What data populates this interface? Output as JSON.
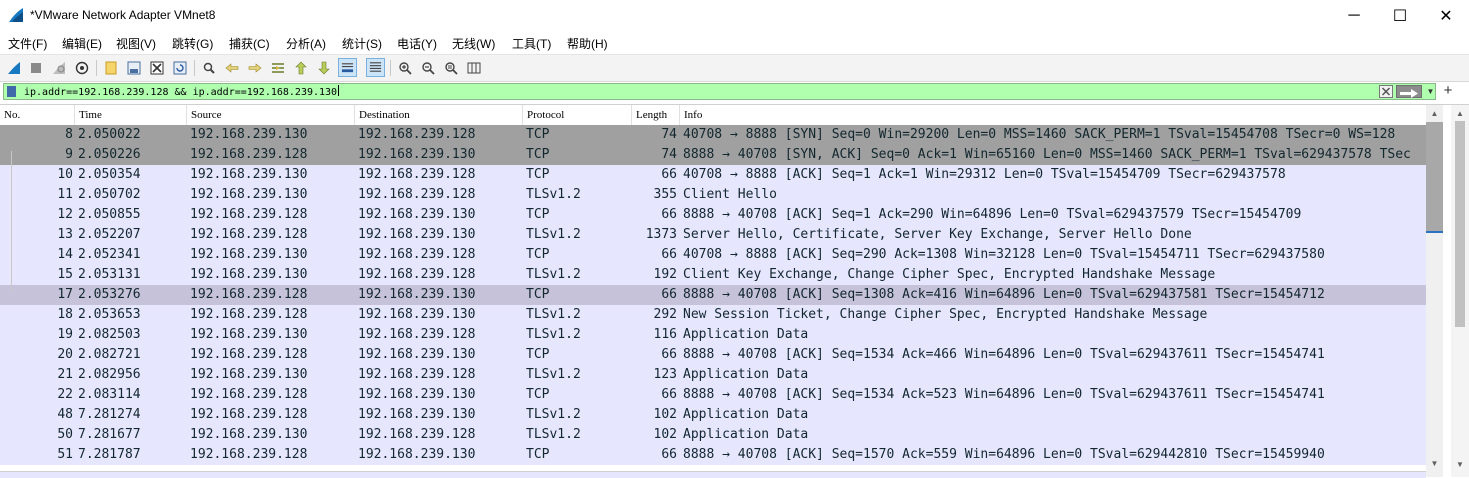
{
  "window": {
    "title": "*VMware Network Adapter VMnet8",
    "minimize_glyph": "─",
    "maximize_glyph": "☐",
    "close_glyph": "✕",
    "app_icon": "wireshark-fin-icon"
  },
  "menu": [
    "文件(F)",
    "编辑(E)",
    "视图(V)",
    "跳转(G)",
    "捕获(C)",
    "分析(A)",
    "统计(S)",
    "电话(Y)",
    "无线(W)",
    "工具(T)",
    "帮助(H)"
  ],
  "toolbar": {
    "icons": [
      "start-capture-icon",
      "stop-capture-icon",
      "restart-capture-icon",
      "capture-options-icon",
      "open-file-icon",
      "save-file-icon",
      "close-file-icon",
      "reload-file-icon",
      "find-packet-icon",
      "go-back-icon",
      "go-forward-icon",
      "go-to-packet-icon",
      "go-first-icon",
      "go-last-icon",
      "auto-scroll-icon",
      "colorize-icon",
      "zoom-in-icon",
      "zoom-out-icon",
      "normal-size-icon",
      "resize-columns-icon"
    ]
  },
  "filter": {
    "value": "ip.addr==192.168.239.128 && ip.addr==192.168.239.130",
    "background": "#afffaf"
  },
  "columns": [
    "No.",
    "Time",
    "Source",
    "Destination",
    "Protocol",
    "Length",
    "Info"
  ],
  "colors": {
    "tcp_row": "#e7e6ff",
    "related_row": "#a0a0a0",
    "selected_row": "#c6c2d9",
    "row_text": "#12272e"
  },
  "packets": [
    {
      "no": "8",
      "time": "2.050022",
      "src": "192.168.239.130",
      "dst": "192.168.239.128",
      "proto": "TCP",
      "len": "74",
      "info": "40708 → 8888 [SYN] Seq=0 Win=29200 Len=0 MSS=1460 SACK_PERM=1 TSval=15454708 TSecr=0 WS=128",
      "style": "gray"
    },
    {
      "no": "9",
      "time": "2.050226",
      "src": "192.168.239.128",
      "dst": "192.168.239.130",
      "proto": "TCP",
      "len": "74",
      "info": "8888 → 40708 [SYN, ACK] Seq=0 Ack=1 Win=65160 Len=0 MSS=1460 SACK_PERM=1 TSval=629437578 TSec",
      "style": "gray"
    },
    {
      "no": "10",
      "time": "2.050354",
      "src": "192.168.239.130",
      "dst": "192.168.239.128",
      "proto": "TCP",
      "len": "66",
      "info": "40708 → 8888 [ACK] Seq=1 Ack=1 Win=29312 Len=0 TSval=15454709 TSecr=629437578",
      "style": "tcp"
    },
    {
      "no": "11",
      "time": "2.050702",
      "src": "192.168.239.130",
      "dst": "192.168.239.128",
      "proto": "TLSv1.2",
      "len": "355",
      "info": "Client Hello",
      "style": "tcp"
    },
    {
      "no": "12",
      "time": "2.050855",
      "src": "192.168.239.128",
      "dst": "192.168.239.130",
      "proto": "TCP",
      "len": "66",
      "info": "8888 → 40708 [ACK] Seq=1 Ack=290 Win=64896 Len=0 TSval=629437579 TSecr=15454709",
      "style": "tcp"
    },
    {
      "no": "13",
      "time": "2.052207",
      "src": "192.168.239.128",
      "dst": "192.168.239.130",
      "proto": "TLSv1.2",
      "len": "1373",
      "info": "Server Hello, Certificate, Server Key Exchange, Server Hello Done",
      "style": "tcp"
    },
    {
      "no": "14",
      "time": "2.052341",
      "src": "192.168.239.130",
      "dst": "192.168.239.128",
      "proto": "TCP",
      "len": "66",
      "info": "40708 → 8888 [ACK] Seq=290 Ack=1308 Win=32128 Len=0 TSval=15454711 TSecr=629437580",
      "style": "tcp"
    },
    {
      "no": "15",
      "time": "2.053131",
      "src": "192.168.239.130",
      "dst": "192.168.239.128",
      "proto": "TLSv1.2",
      "len": "192",
      "info": "Client Key Exchange, Change Cipher Spec, Encrypted Handshake Message",
      "style": "tcp"
    },
    {
      "no": "17",
      "time": "2.053276",
      "src": "192.168.239.128",
      "dst": "192.168.239.130",
      "proto": "TCP",
      "len": "66",
      "info": "8888 → 40708 [ACK] Seq=1308 Ack=416 Win=64896 Len=0 TSval=629437581 TSecr=15454712",
      "style": "sel"
    },
    {
      "no": "18",
      "time": "2.053653",
      "src": "192.168.239.128",
      "dst": "192.168.239.130",
      "proto": "TLSv1.2",
      "len": "292",
      "info": "New Session Ticket, Change Cipher Spec, Encrypted Handshake Message",
      "style": "tcp"
    },
    {
      "no": "19",
      "time": "2.082503",
      "src": "192.168.239.130",
      "dst": "192.168.239.128",
      "proto": "TLSv1.2",
      "len": "116",
      "info": "Application Data",
      "style": "tcp"
    },
    {
      "no": "20",
      "time": "2.082721",
      "src": "192.168.239.128",
      "dst": "192.168.239.130",
      "proto": "TCP",
      "len": "66",
      "info": "8888 → 40708 [ACK] Seq=1534 Ack=466 Win=64896 Len=0 TSval=629437611 TSecr=15454741",
      "style": "tcp"
    },
    {
      "no": "21",
      "time": "2.082956",
      "src": "192.168.239.130",
      "dst": "192.168.239.128",
      "proto": "TLSv1.2",
      "len": "123",
      "info": "Application Data",
      "style": "tcp"
    },
    {
      "no": "22",
      "time": "2.083114",
      "src": "192.168.239.128",
      "dst": "192.168.239.130",
      "proto": "TCP",
      "len": "66",
      "info": "8888 → 40708 [ACK] Seq=1534 Ack=523 Win=64896 Len=0 TSval=629437611 TSecr=15454741",
      "style": "tcp"
    },
    {
      "no": "48",
      "time": "7.281274",
      "src": "192.168.239.128",
      "dst": "192.168.239.130",
      "proto": "TLSv1.2",
      "len": "102",
      "info": "Application Data",
      "style": "tcp"
    },
    {
      "no": "50",
      "time": "7.281677",
      "src": "192.168.239.130",
      "dst": "192.168.239.128",
      "proto": "TLSv1.2",
      "len": "102",
      "info": "Application Data",
      "style": "tcp"
    },
    {
      "no": "51",
      "time": "7.281787",
      "src": "192.168.239.128",
      "dst": "192.168.239.130",
      "proto": "TCP",
      "len": "66",
      "info": "8888 → 40708 [ACK] Seq=1570 Ack=559 Win=64896 Len=0 TSval=629442810 TSecr=15459940",
      "style": "tcp"
    }
  ]
}
